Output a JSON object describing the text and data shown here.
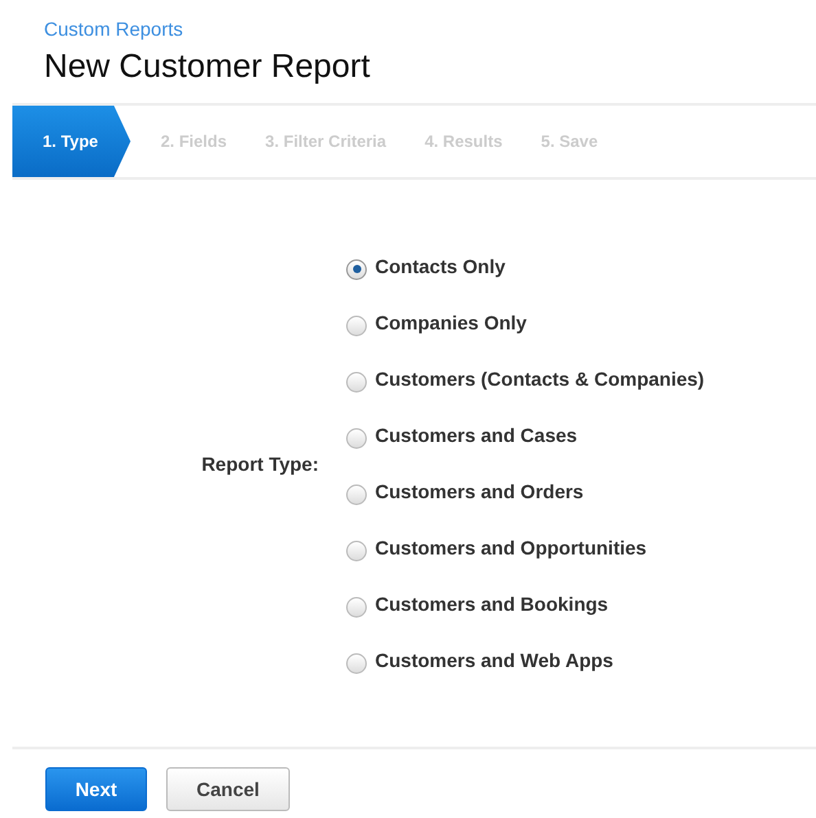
{
  "breadcrumb": "Custom Reports",
  "title": "New Customer Report",
  "steps": [
    {
      "label": "1. Type",
      "selected": true
    },
    {
      "label": "2. Fields",
      "selected": false
    },
    {
      "label": "3. Filter Criteria",
      "selected": false
    },
    {
      "label": "4. Results",
      "selected": false
    },
    {
      "label": "5. Save",
      "selected": false
    }
  ],
  "report_type": {
    "label": "Report Type:",
    "options": [
      {
        "label": "Contacts Only",
        "selected": true
      },
      {
        "label": "Companies Only",
        "selected": false
      },
      {
        "label": "Customers (Contacts & Companies)",
        "selected": false
      },
      {
        "label": "Customers and Cases",
        "selected": false
      },
      {
        "label": "Customers and Orders",
        "selected": false
      },
      {
        "label": "Customers and Opportunities",
        "selected": false
      },
      {
        "label": "Customers and Bookings",
        "selected": false
      },
      {
        "label": "Customers and Web Apps",
        "selected": false
      }
    ]
  },
  "buttons": [
    {
      "label": "Next",
      "kind": "primary"
    },
    {
      "label": "Cancel",
      "kind": "secondary"
    }
  ]
}
